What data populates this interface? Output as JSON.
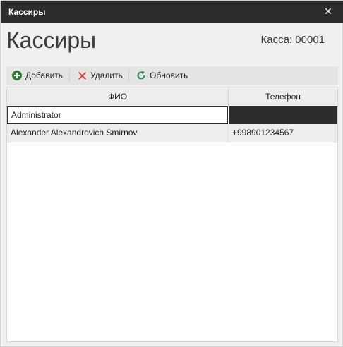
{
  "window": {
    "title": "Кассиры",
    "close_label": "×"
  },
  "header": {
    "page_title": "Кассиры",
    "kassa": "Касса: 00001"
  },
  "toolbar": {
    "add_label": "Добавить",
    "delete_label": "Удалить",
    "refresh_label": "Обновить",
    "icons": {
      "add": "plus-circle-icon",
      "delete": "x-icon",
      "refresh": "refresh-icon"
    },
    "colors": {
      "add": "#2e7d32",
      "delete": "#e53935",
      "refresh": "#2e8b57"
    }
  },
  "grid": {
    "columns": [
      "ФИО",
      "Телефон"
    ],
    "rows": [
      {
        "name": "Administrator",
        "phone": ""
      },
      {
        "name": "Alexander Alexandrovich Smirnov",
        "phone": "+998901234567"
      }
    ]
  }
}
